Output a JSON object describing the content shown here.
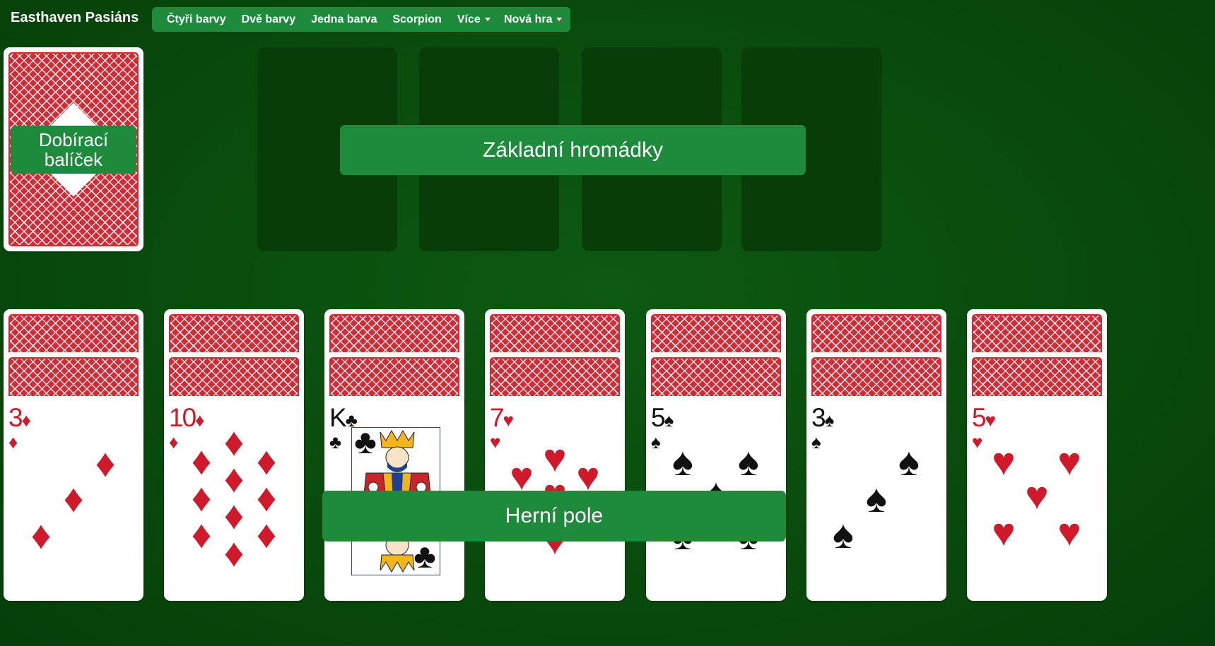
{
  "app": {
    "brand": "Easthaven Pasiáns"
  },
  "nav": {
    "items": [
      {
        "label": "Čtyři barvy"
      },
      {
        "label": "Dvě barvy"
      },
      {
        "label": "Jedna barva"
      },
      {
        "label": "Scorpion"
      },
      {
        "label": "Více"
      }
    ],
    "new_game": "Nová hra"
  },
  "stock": {
    "label": "Dobírací balíček"
  },
  "foundations": {
    "label": "Základní hromádky",
    "count": 4
  },
  "tableau": {
    "label": "Herní pole",
    "columns": [
      {
        "rank": "3",
        "suit": "♦",
        "color": "red",
        "face_down": 2
      },
      {
        "rank": "10",
        "suit": "♦",
        "color": "red",
        "face_down": 2
      },
      {
        "rank": "K",
        "suit": "♣",
        "color": "black",
        "face_down": 2
      },
      {
        "rank": "7",
        "suit": "♥",
        "color": "red",
        "face_down": 2
      },
      {
        "rank": "5",
        "suit": "♠",
        "color": "black",
        "face_down": 2
      },
      {
        "rank": "3",
        "suit": "♠",
        "color": "black",
        "face_down": 2
      },
      {
        "rank": "5",
        "suit": "♥",
        "color": "red",
        "face_down": 2
      }
    ]
  },
  "colors": {
    "felt": "#0a4f0e",
    "accent": "#1e8a3c",
    "card_back": "#d22b35",
    "red_suit": "#d0192b"
  }
}
